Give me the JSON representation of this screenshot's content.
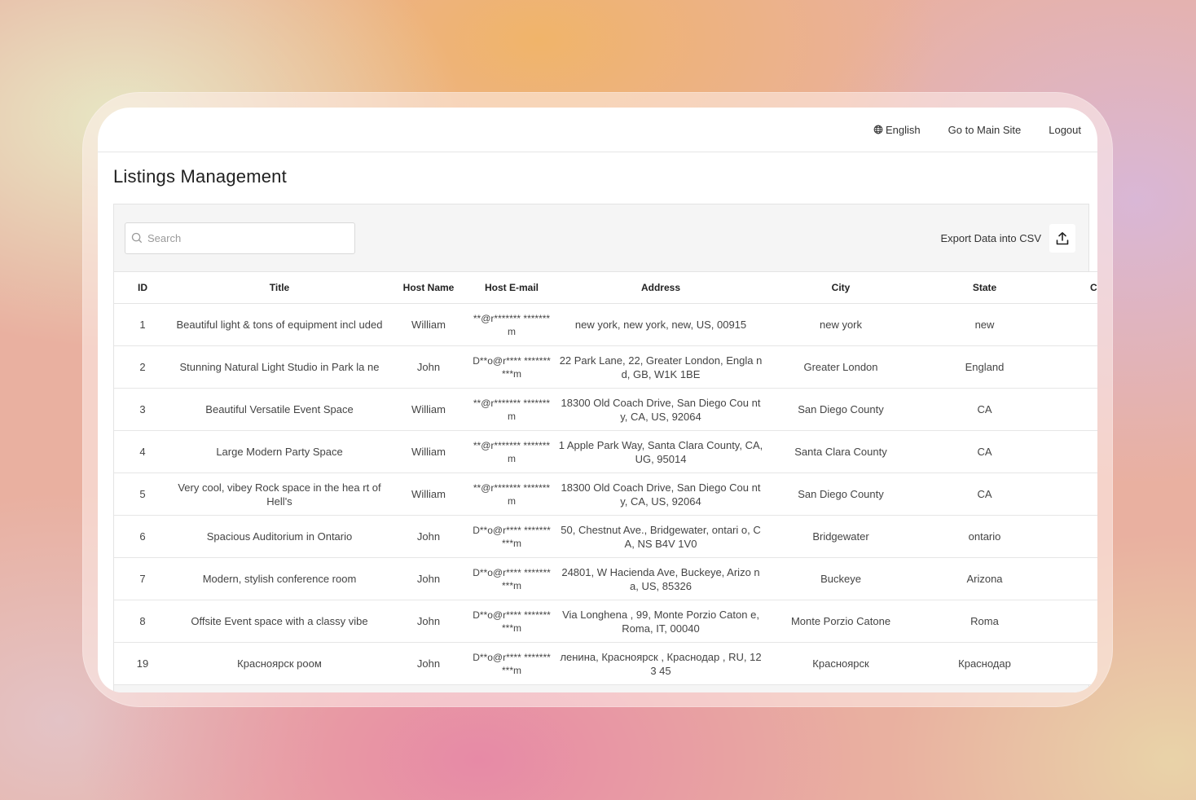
{
  "topbar": {
    "language": "English",
    "main_site": "Go to Main Site",
    "logout": "Logout"
  },
  "page_title": "Listings Management",
  "search": {
    "placeholder": "Search",
    "value": ""
  },
  "export": {
    "label": "Export Data into CSV"
  },
  "table": {
    "columns": [
      "ID",
      "Title",
      "Host Name",
      "Host E-mail",
      "Address",
      "City",
      "State",
      "Co"
    ],
    "rows": [
      {
        "id": "1",
        "title": "Beautiful light & tons of equipment incl uded",
        "host": "William",
        "email": "**@r******* *******m",
        "address": "new york, new york, new, US, 00915",
        "city": "new york",
        "state": "new"
      },
      {
        "id": "2",
        "title": "Stunning Natural Light Studio in Park la ne",
        "host": "John",
        "email": "D**o@r**** **********m",
        "address": "22 Park Lane, 22, Greater London, Engla nd, GB, W1K 1BE",
        "city": "Greater London",
        "state": "England"
      },
      {
        "id": "3",
        "title": "Beautiful Versatile Event Space",
        "host": "William",
        "email": "**@r******* *******m",
        "address": "18300 Old Coach Drive, San Diego Cou nty, CA, US, 92064",
        "city": "San Diego County",
        "state": "CA"
      },
      {
        "id": "4",
        "title": "Large Modern Party Space",
        "host": "William",
        "email": "**@r******* *******m",
        "address": "1 Apple Park Way, Santa Clara County, CA, UG, 95014",
        "city": "Santa Clara County",
        "state": "CA"
      },
      {
        "id": "5",
        "title": "Very cool, vibey Rock space in the hea rt of Hell's",
        "host": "William",
        "email": "**@r******* *******m",
        "address": "18300 Old Coach Drive, San Diego Cou nty, CA, US, 92064",
        "city": "San Diego County",
        "state": "CA"
      },
      {
        "id": "6",
        "title": "Spacious Auditorium in Ontario",
        "host": "John",
        "email": "D**o@r**** **********m",
        "address": "50, Chestnut Ave., Bridgewater, ontari o, CA, NS B4V 1V0",
        "city": "Bridgewater",
        "state": "ontario"
      },
      {
        "id": "7",
        "title": "Modern, stylish conference room",
        "host": "John",
        "email": "D**o@r**** **********m",
        "address": "24801, W Hacienda Ave, Buckeye, Arizo na, US, 85326",
        "city": "Buckeye",
        "state": "Arizona"
      },
      {
        "id": "8",
        "title": "Offsite Event space with a classy vibe",
        "host": "John",
        "email": "D**o@r**** **********m",
        "address": "Via Longhena , 99, Monte Porzio Caton e, Roma, IT, 00040",
        "city": "Monte Porzio Catone",
        "state": "Roma"
      },
      {
        "id": "19",
        "title": "Красноярск роом",
        "host": "John",
        "email": "D**o@r**** **********m",
        "address": "ленина, Красноярск , Краснодар , RU, 123 45",
        "city": "Красноярск",
        "state": "Краснодар"
      }
    ]
  }
}
